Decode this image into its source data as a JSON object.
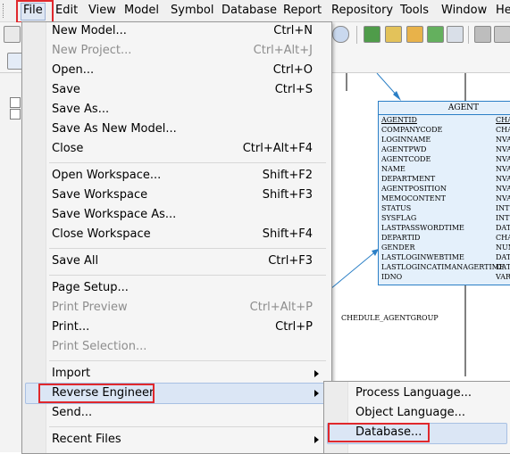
{
  "menubar": {
    "items": [
      "File",
      "Edit",
      "View",
      "Model",
      "Symbol",
      "Database",
      "Report",
      "Repository",
      "Tools",
      "Window",
      "He"
    ]
  },
  "file_menu": {
    "items": [
      {
        "label": "New Model...",
        "shortcut": "Ctrl+N"
      },
      {
        "label": "New Project...",
        "shortcut": "Ctrl+Alt+J",
        "disabled": true
      },
      {
        "label": "Open...",
        "shortcut": "Ctrl+O"
      },
      {
        "label": "Save",
        "shortcut": "Ctrl+S"
      },
      {
        "label": "Save As...",
        "shortcut": ""
      },
      {
        "label": "Save As New Model...",
        "shortcut": ""
      },
      {
        "label": "Close",
        "shortcut": "Ctrl+Alt+F4"
      },
      {
        "label": "Open Workspace...",
        "shortcut": "Shift+F2"
      },
      {
        "label": "Save Workspace",
        "shortcut": "Shift+F3"
      },
      {
        "label": "Save Workspace As...",
        "shortcut": ""
      },
      {
        "label": "Close Workspace",
        "shortcut": "Shift+F4"
      },
      {
        "label": "Save All",
        "shortcut": "Ctrl+F3"
      },
      {
        "label": "Page Setup...",
        "shortcut": ""
      },
      {
        "label": "Print Preview",
        "shortcut": "Ctrl+Alt+P",
        "disabled": true
      },
      {
        "label": "Print...",
        "shortcut": "Ctrl+P"
      },
      {
        "label": "Print Selection...",
        "shortcut": "",
        "disabled": true
      },
      {
        "label": "Import",
        "shortcut": ""
      },
      {
        "label": "Reverse Engineer",
        "shortcut": ""
      },
      {
        "label": "Send...",
        "shortcut": ""
      },
      {
        "label": "Recent Files",
        "shortcut": ""
      }
    ]
  },
  "submenu": {
    "items": [
      "Process Language...",
      "Object Language...",
      "Database..."
    ]
  },
  "diagram": {
    "entity_name": "AGENT",
    "columns": [
      {
        "name": "AGENTID",
        "type": "CHA"
      },
      {
        "name": "COMPANYCODE",
        "type": "CHA"
      },
      {
        "name": "LOGINNAME",
        "type": "NVA"
      },
      {
        "name": "AGENTPWD",
        "type": "NVA"
      },
      {
        "name": "AGENTCODE",
        "type": "NVA"
      },
      {
        "name": "NAME",
        "type": "NVA"
      },
      {
        "name": "DEPARTMENT",
        "type": "NVA"
      },
      {
        "name": "AGENTPOSITION",
        "type": "NVA"
      },
      {
        "name": "MEMOCONTENT",
        "type": "NVA"
      },
      {
        "name": "STATUS",
        "type": "INT"
      },
      {
        "name": "SYSFLAG",
        "type": "INT"
      },
      {
        "name": "LASTPASSWORDTIME",
        "type": "DAT"
      },
      {
        "name": "DEPARTID",
        "type": "CHA"
      },
      {
        "name": "GENDER",
        "type": "NUM"
      },
      {
        "name": "LASTLOGINWEBTIME",
        "type": "DAT"
      },
      {
        "name": "LASTLOGINCATIMANAGERTIME",
        "type": "DAT"
      },
      {
        "name": "IDNO",
        "type": "VAR"
      }
    ],
    "relationship_label": "CHEDULE_AGENTGROUP"
  },
  "colors": {
    "highlight_border": "#e0282c",
    "entity_border": "#2b7fc6",
    "entity_fill": "#e4f0fb",
    "menu_hover": "#dbe6f5"
  }
}
